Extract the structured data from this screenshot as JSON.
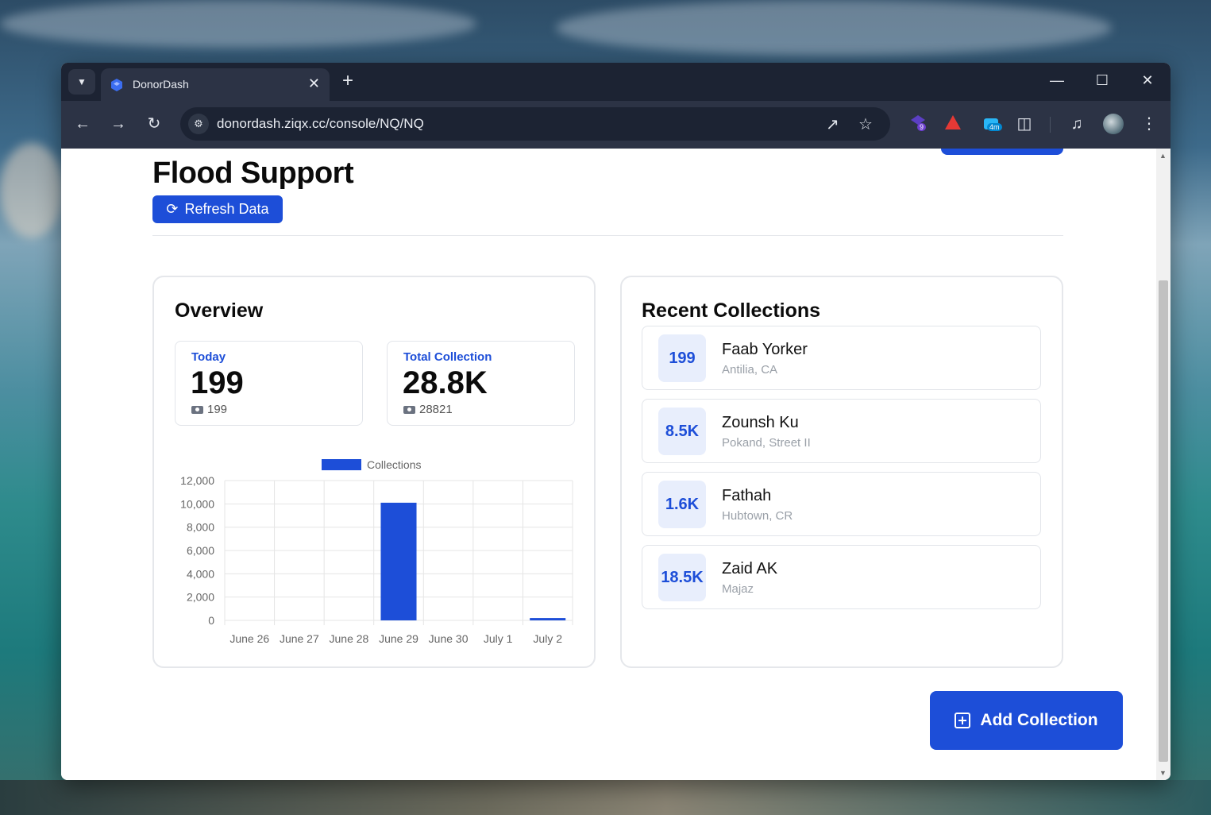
{
  "browser": {
    "tab_title": "DonorDash",
    "url": "donordash.ziqx.cc/console/NQ/NQ",
    "extensions": [
      {
        "name": "extension-purple",
        "badge": "9"
      },
      {
        "name": "extension-red-triangle",
        "badge": ""
      },
      {
        "name": "extension-timer",
        "badge": "4m"
      }
    ]
  },
  "page": {
    "title": "Flood Support",
    "refresh_label": "Refresh Data",
    "add_collection_label": "Add Collection"
  },
  "overview": {
    "heading": "Overview",
    "today": {
      "label": "Today",
      "value": "199",
      "sub": "199"
    },
    "total": {
      "label": "Total Collection",
      "value": "28.8K",
      "sub": "28821"
    }
  },
  "recent": {
    "heading": "Recent Collections",
    "items": [
      {
        "amount": "199",
        "name": "Faab Yorker",
        "location": "Antilia, CA"
      },
      {
        "amount": "8.5K",
        "name": "Zounsh Ku",
        "location": "Pokand, Street II"
      },
      {
        "amount": "1.6K",
        "name": "Fathah",
        "location": "Hubtown, CR"
      },
      {
        "amount": "18.5K",
        "name": "Zaid AK",
        "location": "Majaz"
      }
    ]
  },
  "colors": {
    "accent": "#1d4ed8",
    "accent_light": "#e8eefc"
  },
  "chart_data": {
    "type": "bar",
    "categories": [
      "June 26",
      "June 27",
      "June 28",
      "June 29",
      "June 30",
      "July 1",
      "July 2"
    ],
    "series": [
      {
        "name": "Collections",
        "values": [
          0,
          0,
          0,
          10100,
          0,
          0,
          199
        ]
      }
    ],
    "yticks": [
      "12,000",
      "10,000",
      "8,000",
      "6,000",
      "4,000",
      "2,000",
      "0"
    ],
    "ylim": [
      0,
      12000
    ],
    "legend": "top",
    "grid": true
  }
}
